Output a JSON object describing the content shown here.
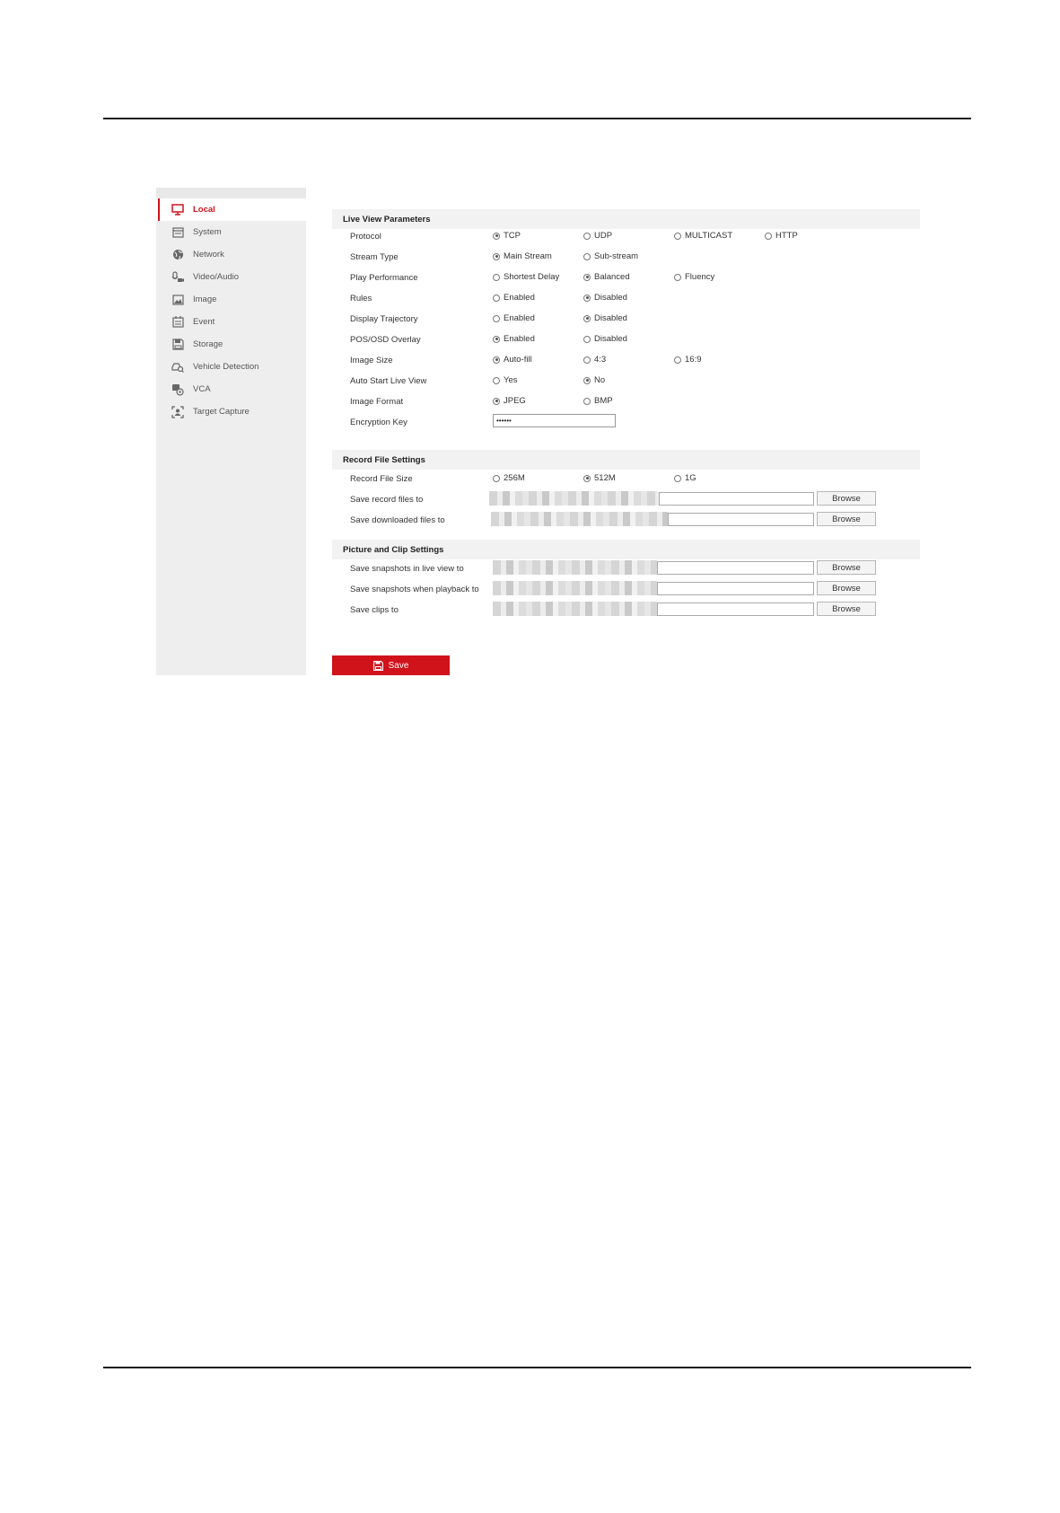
{
  "sidebar": {
    "items": [
      {
        "label": "Local",
        "icon": "monitor-icon",
        "active": true
      },
      {
        "label": "System",
        "icon": "system-icon",
        "active": false
      },
      {
        "label": "Network",
        "icon": "globe-icon",
        "active": false
      },
      {
        "label": "Video/Audio",
        "icon": "mic-camera-icon",
        "active": false
      },
      {
        "label": "Image",
        "icon": "image-icon",
        "active": false
      },
      {
        "label": "Event",
        "icon": "calendar-icon",
        "active": false
      },
      {
        "label": "Storage",
        "icon": "floppy-icon",
        "active": false
      },
      {
        "label": "Vehicle Detection",
        "icon": "vehicle-search-icon",
        "active": false
      },
      {
        "label": "VCA",
        "icon": "vca-icon",
        "active": false
      },
      {
        "label": "Target Capture",
        "icon": "target-capture-icon",
        "active": false
      }
    ]
  },
  "live_view": {
    "title": "Live View Parameters",
    "rows": [
      {
        "label": "Protocol",
        "options": [
          "TCP",
          "UDP",
          "MULTICAST",
          "HTTP"
        ],
        "selected": 0
      },
      {
        "label": "Stream Type",
        "options": [
          "Main Stream",
          "Sub-stream"
        ],
        "selected": 0
      },
      {
        "label": "Play Performance",
        "options": [
          "Shortest Delay",
          "Balanced",
          "Fluency"
        ],
        "selected": 1
      },
      {
        "label": "Rules",
        "options": [
          "Enabled",
          "Disabled"
        ],
        "selected": 1
      },
      {
        "label": "Display Trajectory",
        "options": [
          "Enabled",
          "Disabled"
        ],
        "selected": 1
      },
      {
        "label": "POS/OSD Overlay",
        "options": [
          "Enabled",
          "Disabled"
        ],
        "selected": 0
      },
      {
        "label": "Image Size",
        "options": [
          "Auto-fill",
          "4:3",
          "16:9"
        ],
        "selected": 0
      },
      {
        "label": "Auto Start Live View",
        "options": [
          "Yes",
          "No"
        ],
        "selected": 1
      },
      {
        "label": "Image Format",
        "options": [
          "JPEG",
          "BMP"
        ],
        "selected": 0
      }
    ],
    "encryption": {
      "label": "Encryption Key",
      "value": "••••••"
    }
  },
  "record_file": {
    "title": "Record File Settings",
    "size_row": {
      "label": "Record File Size",
      "options": [
        "256M",
        "512M",
        "1G"
      ],
      "selected": 1
    },
    "paths": [
      {
        "label": "Save record files to",
        "button": "Browse"
      },
      {
        "label": "Save downloaded files to",
        "button": "Browse"
      }
    ]
  },
  "picture_clip": {
    "title": "Picture and Clip Settings",
    "paths": [
      {
        "label": "Save snapshots in live view to",
        "button": "Browse"
      },
      {
        "label": "Save snapshots when playback to",
        "button": "Browse"
      },
      {
        "label": "Save clips to",
        "button": "Browse"
      }
    ]
  },
  "save_button": {
    "label": "Save"
  },
  "colors": {
    "accent": "#d0121b",
    "sidebar_bg": "#eeeeee",
    "section_bg": "#f2f2f2"
  }
}
